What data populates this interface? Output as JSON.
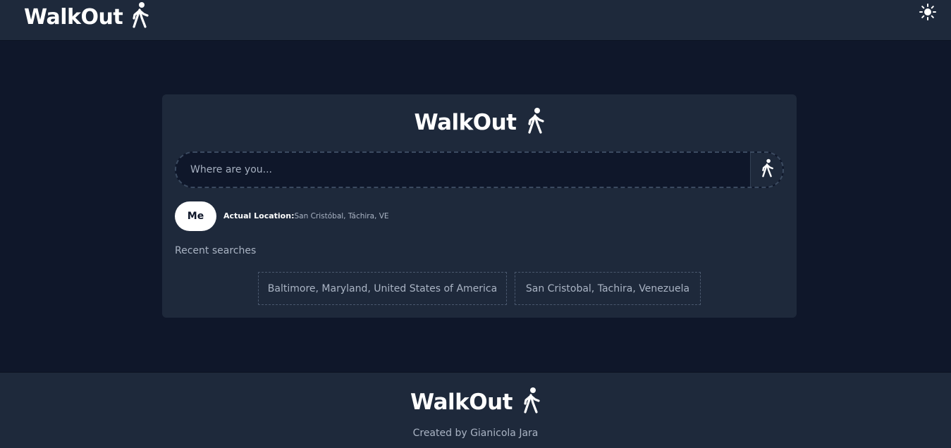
{
  "header": {
    "brand": "WalkOut",
    "brand_icon": "walking-person-icon",
    "theme_icon": "sun-icon"
  },
  "card": {
    "brand": "WalkOut",
    "search": {
      "placeholder": "Where are you...",
      "value": "",
      "button_icon": "walking-person-icon"
    },
    "me_button": "Me",
    "location_label": "Actual Location:",
    "location_value": "San Cristóbal, Táchira, VE",
    "recent_title": "Recent searches",
    "recent": [
      "Baltimore, Maryland, United States of America",
      "San Cristobal, Tachira, Venezuela"
    ]
  },
  "footer": {
    "brand": "WalkOut",
    "credit": "Created by Gianicola Jara"
  },
  "colors": {
    "page_bg": "#0f172a",
    "surface": "#1e293b",
    "text": "#ffffff",
    "muted": "#aab4c4"
  }
}
